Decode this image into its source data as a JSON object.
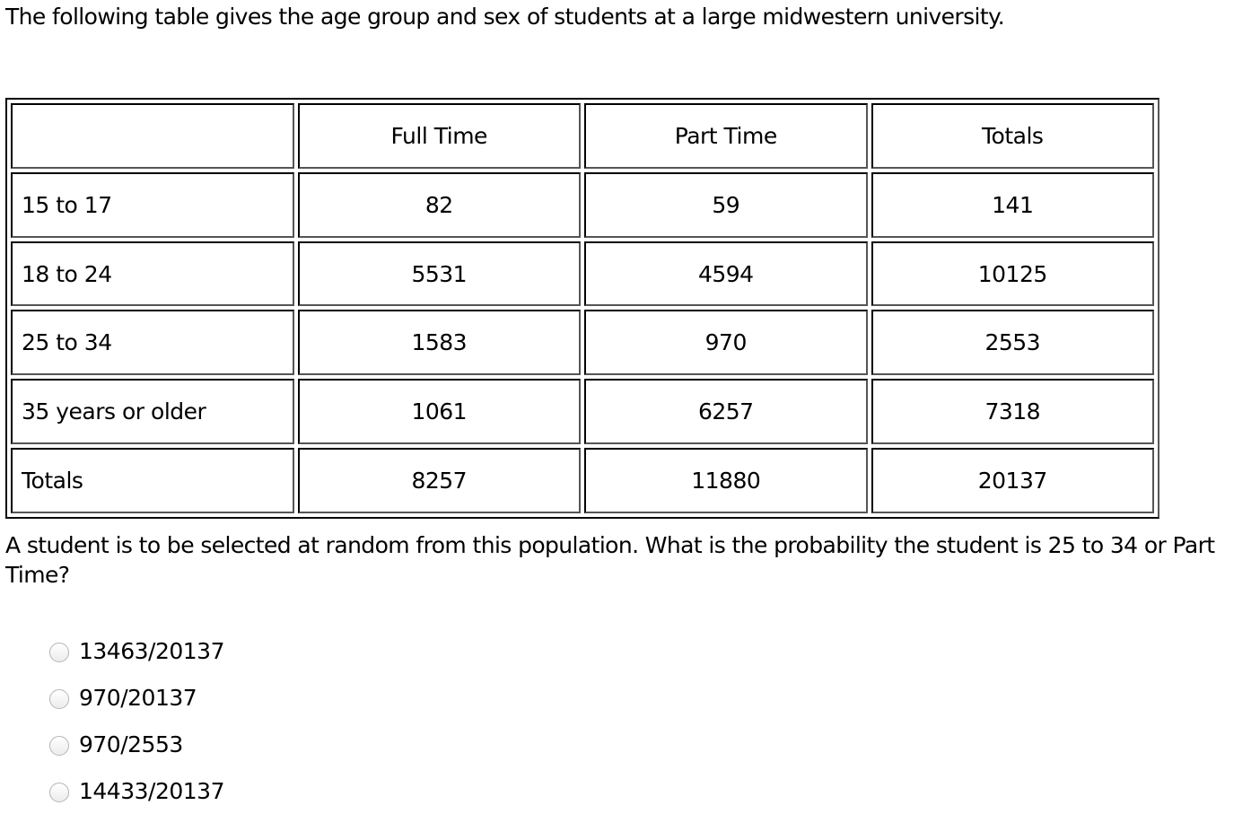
{
  "intro": "The following table gives the age group and sex of students at a large midwestern university.",
  "table": {
    "headers": [
      "",
      "Full Time",
      "Part Time",
      "Totals"
    ],
    "rows": [
      {
        "label": "15 to 17",
        "full_time": "82",
        "part_time": "59",
        "totals": "141"
      },
      {
        "label": "18 to 24",
        "full_time": "5531",
        "part_time": "4594",
        "totals": "10125"
      },
      {
        "label": "25 to 34",
        "full_time": "1583",
        "part_time": "970",
        "totals": "2553"
      },
      {
        "label": "35 years or older",
        "full_time": "1061",
        "part_time": "6257",
        "totals": "7318"
      },
      {
        "label": "Totals",
        "full_time": "8257",
        "part_time": "11880",
        "totals": "20137"
      }
    ]
  },
  "question": "A student is to be selected at random from this population.  What is the probability the student is 25 to 34 or Part Time?",
  "options": [
    {
      "label": "13463/20137",
      "selected": false
    },
    {
      "label": "970/20137",
      "selected": false
    },
    {
      "label": "970/2553",
      "selected": false
    },
    {
      "label": "14433/20137",
      "selected": false
    }
  ]
}
